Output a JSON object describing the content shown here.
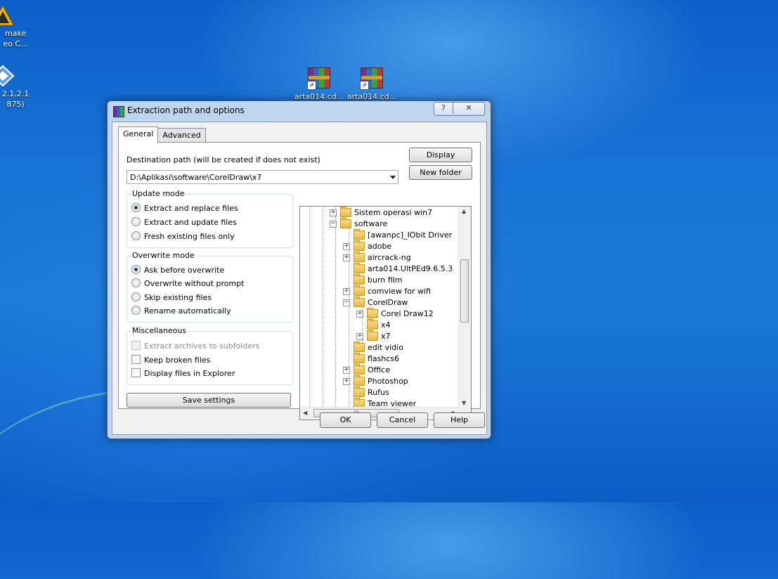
{
  "desktop": {
    "icons": [
      {
        "label_line1": "make",
        "label_line2": "eo C...",
        "icon": "video-app-icon"
      },
      {
        "label_line1": "2.1.2.1",
        "label_line2": "875)",
        "icon": "installer-icon"
      },
      {
        "label_line1": "arta014.cd...",
        "icon": "winrar-archive-icon"
      },
      {
        "label_line1": "arta014.cd...",
        "icon": "winrar-archive-icon"
      }
    ]
  },
  "dialog": {
    "title": "Extraction path and options",
    "help_glyph": "?",
    "close_glyph": "✕",
    "tabs": [
      {
        "label": "General",
        "active": true
      },
      {
        "label": "Advanced",
        "active": false
      }
    ],
    "destination": {
      "label": "Destination path (will be created if does not exist)",
      "value": "D:\\Aplikasi\\software\\CorelDraw\\x7"
    },
    "display_button": "Display",
    "new_folder_button": "New folder",
    "update_mode": {
      "title": "Update mode",
      "options": [
        "Extract and replace files",
        "Extract and update files",
        "Fresh existing files only"
      ],
      "selected": 0
    },
    "overwrite_mode": {
      "title": "Overwrite mode",
      "options": [
        "Ask before overwrite",
        "Overwrite without prompt",
        "Skip existing files",
        "Rename automatically"
      ],
      "selected": 0
    },
    "misc": {
      "title": "Miscellaneous",
      "options": [
        {
          "label": "Extract archives to subfolders",
          "checked": false,
          "enabled": false
        },
        {
          "label": "Keep broken files",
          "checked": false,
          "enabled": true
        },
        {
          "label": "Display files in Explorer",
          "checked": false,
          "enabled": true
        }
      ]
    },
    "save_settings_button": "Save settings",
    "tree": [
      {
        "label": "Sistem operasi win7",
        "expander": "+"
      },
      {
        "label": "software",
        "expander": "−"
      },
      {
        "label": "[awanpc]_IObit Driver",
        "expander": ""
      },
      {
        "label": "adobe",
        "expander": "+"
      },
      {
        "label": "aircrack-ng",
        "expander": "+"
      },
      {
        "label": "arta014.UltPEd9.6.5.3",
        "expander": ""
      },
      {
        "label": "burn film",
        "expander": ""
      },
      {
        "label": "comview for wifi",
        "expander": "+"
      },
      {
        "label": "CorelDraw",
        "expander": "−"
      },
      {
        "label": "Corel Draw12",
        "expander": "+"
      },
      {
        "label": "x4",
        "expander": ""
      },
      {
        "label": "x7",
        "expander": "+",
        "selected": true
      },
      {
        "label": "edit vidio",
        "expander": ""
      },
      {
        "label": "flashcs6",
        "expander": ""
      },
      {
        "label": "Office",
        "expander": "+"
      },
      {
        "label": "Photoshop",
        "expander": "+"
      },
      {
        "label": "Rufus",
        "expander": ""
      },
      {
        "label": "Team viewer",
        "expander": ""
      }
    ],
    "scroll_grip": "III",
    "ok_button": "OK",
    "cancel_button": "Cancel",
    "help_button": "Help"
  }
}
